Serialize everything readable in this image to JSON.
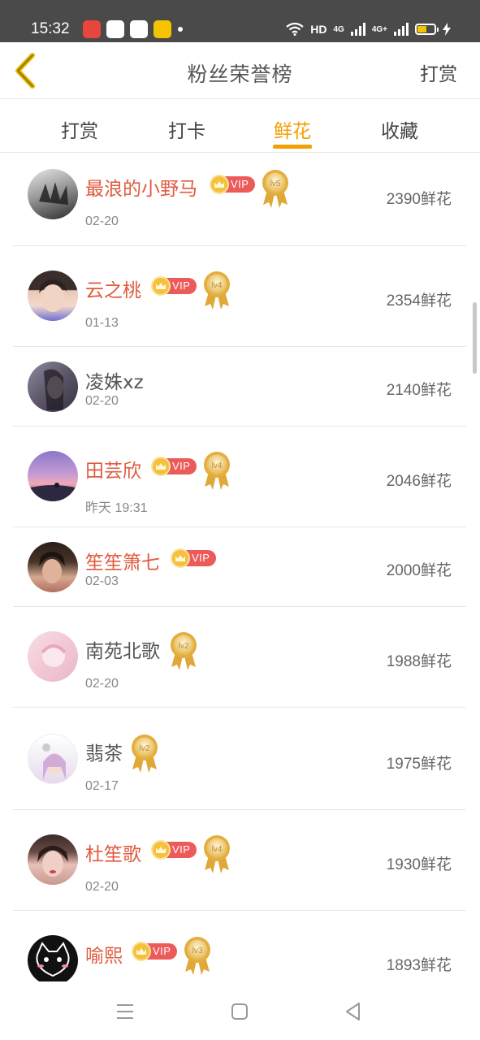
{
  "status_bar": {
    "time": "15:32",
    "network_label": "HD",
    "signal1": "4G",
    "signal2": "4G+"
  },
  "header": {
    "title": "粉丝荣誉榜",
    "action": "打赏"
  },
  "tabs": [
    {
      "label": "打赏",
      "active": false
    },
    {
      "label": "打卡",
      "active": false
    },
    {
      "label": "鲜花",
      "active": true
    },
    {
      "label": "收藏",
      "active": false
    }
  ],
  "rows": [
    {
      "name": "最浪的小野马",
      "vip": true,
      "level": "lv5",
      "date": "02-20",
      "amount": "2390鲜花"
    },
    {
      "name": "云之桃",
      "vip": true,
      "level": "lv4",
      "date": "01-13",
      "amount": "2354鲜花"
    },
    {
      "name": "凌姝xz",
      "vip": false,
      "level": "",
      "date": "02-20",
      "amount": "2140鲜花"
    },
    {
      "name": "田芸欣",
      "vip": true,
      "level": "lv4",
      "date": "昨天 19:31",
      "amount": "2046鲜花"
    },
    {
      "name": "笙笙箫七",
      "vip": true,
      "level": "",
      "date": "02-03",
      "amount": "2000鲜花"
    },
    {
      "name": "南苑北歌",
      "vip": false,
      "level": "lv2",
      "date": "02-20",
      "amount": "1988鲜花"
    },
    {
      "name": "翡茶",
      "vip": false,
      "level": "lv2",
      "date": "02-17",
      "amount": "1975鲜花"
    },
    {
      "name": "杜笙歌",
      "vip": true,
      "level": "lv4",
      "date": "02-20",
      "amount": "1930鲜花"
    },
    {
      "name": "喻熙",
      "vip": true,
      "level": "lv3",
      "date": "",
      "amount": "1893鲜花"
    }
  ],
  "vip_label": "VIP",
  "colors": {
    "accent": "#f0a000",
    "vip_name": "#e05a3f",
    "vip_badge": "#ec5a5a"
  }
}
